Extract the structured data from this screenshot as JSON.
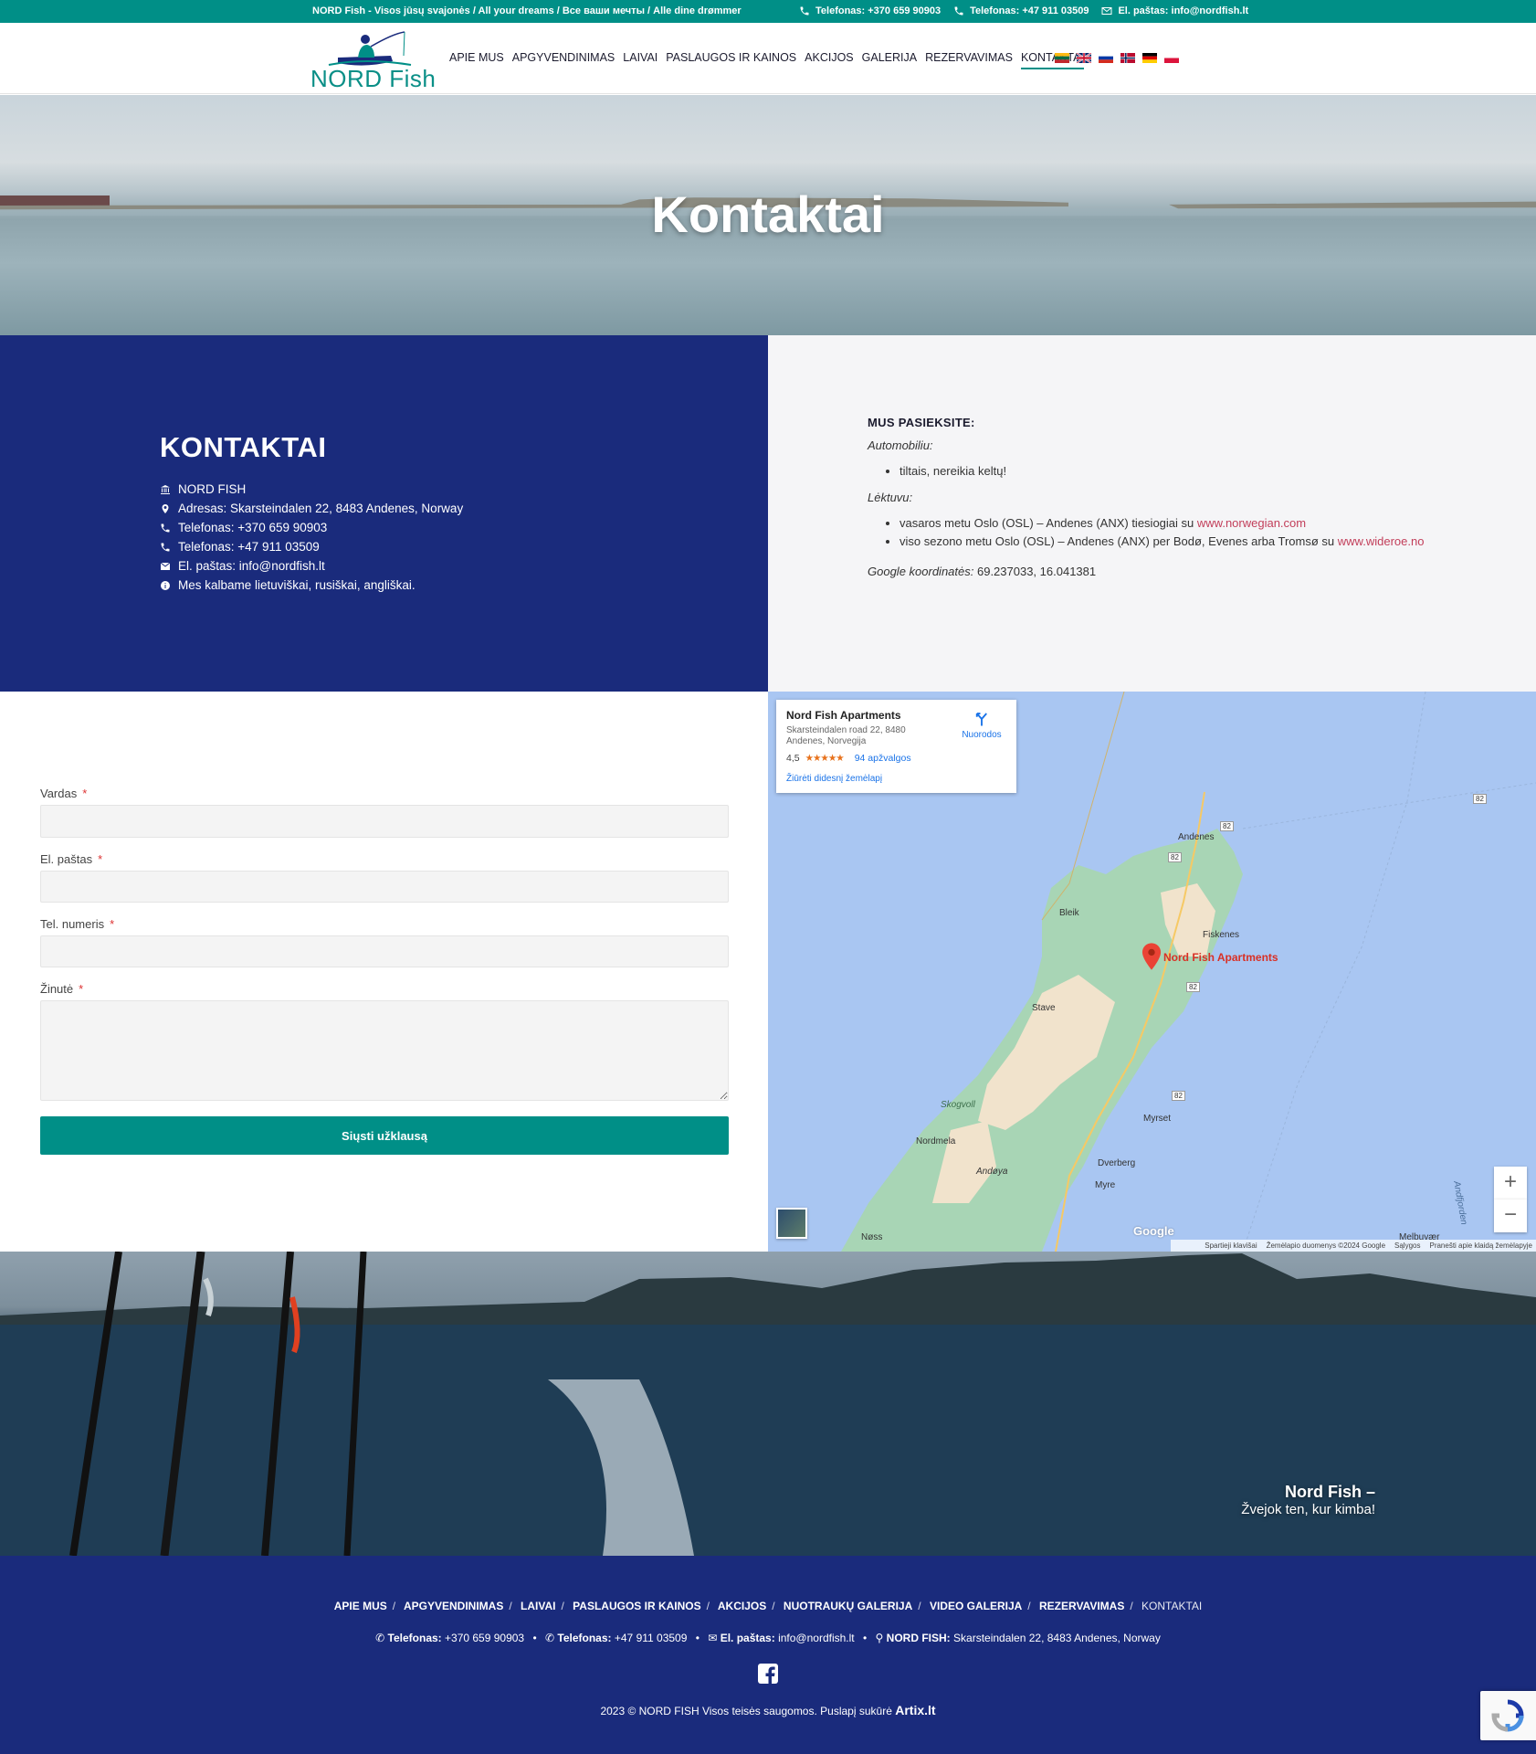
{
  "topbar": {
    "tagline": "NORD Fish - Visos jūsų svajonės / All your dreams / Все ваши мечты / Alle dine drømmer",
    "phone1": "Telefonas: +370 659 90903",
    "phone2": "Telefonas: +47 911 03509",
    "email": "El. paštas: info@nordfish.lt"
  },
  "header": {
    "logo_text": "NORD Fish",
    "nav": [
      "APIE MUS",
      "APGYVENDINIMAS",
      "LAIVAI",
      "PASLAUGOS IR KAINOS",
      "AKCIJOS",
      "GALERIJA",
      "REZERVAVIMAS",
      "KONTAKTAI"
    ],
    "active_index": 7,
    "flags": [
      "lt-flag",
      "en-flag",
      "ru-flag",
      "no-flag",
      "de-flag",
      "pl-flag"
    ]
  },
  "hero": {
    "title": "Kontaktai"
  },
  "contact": {
    "heading": "KONTAKTAI",
    "items": [
      {
        "icon": "bank-icon",
        "text": "NORD FISH"
      },
      {
        "icon": "map-marker-icon",
        "text": "Adresas: Skarsteindalen 22, 8483 Andenes, Norway"
      },
      {
        "icon": "phone-icon",
        "text": "Telefonas: +370 659 90903"
      },
      {
        "icon": "phone-icon",
        "text": "Telefonas: +47 911 03509"
      },
      {
        "icon": "envelope-icon",
        "text": "El. paštas: info@nordfish.lt"
      },
      {
        "icon": "info-icon",
        "text": "Mes kalbame lietuviškai, rusiškai, angliškai."
      }
    ]
  },
  "directions": {
    "heading": "MUS PASIEKSITE:",
    "car_label": "Automobiliu:",
    "car_items": [
      "tiltais, nereikia keltų!"
    ],
    "plane_label": "Lėktuvu:",
    "plane_item1_text": "vasaros metu Oslo (OSL) – Andenes (ANX) tiesiogiai su",
    "plane_item1_link": "www.norwegian.com",
    "plane_item2_text": "viso sezono metu Oslo (OSL) – Andenes (ANX) per Bodø, Evenes arba Tromsø su",
    "plane_item2_link": "www.wideroe.no",
    "coords_label": "Google koordinatės:",
    "coords_value": "69.237033, 16.041381"
  },
  "form": {
    "name_label": "Vardas",
    "email_label": "El. paštas",
    "phone_label": "Tel. numeris",
    "message_label": "Žinutė",
    "required_mark": "*",
    "submit_label": "Siųsti užklausą"
  },
  "map": {
    "card_title": "Nord Fish Apartments",
    "card_address": "Skarsteindalen road 22, 8480 Andenes, Norvegija",
    "rating": "4,5",
    "stars": "★★★★★",
    "reviews": "94 apžvalgos",
    "bigger_map": "Žiūrėti didesnį žemėlapį",
    "directions_label": "Nuorodos",
    "pin_label": "Nord Fish Apartments",
    "places": [
      "Andenes",
      "Bleik",
      "Fiskenes",
      "Stave",
      "Skogvoll",
      "Nordmela",
      "Andøya",
      "Myrset",
      "Dverberg",
      "Myre",
      "Nøss",
      "Andfjorden",
      "Melbuvær"
    ],
    "road_labels": [
      "82",
      "82",
      "82",
      "82",
      "82"
    ],
    "zoom_in": "+",
    "zoom_out": "−",
    "google": "Google",
    "footer_items": [
      "Spartieji klavišai",
      "Žemėlapio duomenys ©2024 Google",
      "Sąlygos",
      "Pranešti apie klaidą žemėlapyje"
    ]
  },
  "banner": {
    "line1": "Nord Fish –",
    "line2": "Žvejok ten, kur kimba!"
  },
  "footer": {
    "nav": [
      "APIE MUS",
      "APGYVENDINIMAS",
      "LAIVAI",
      "PASLAUGOS IR KAINOS",
      "AKCIJOS",
      "NUOTRAUKŲ GALERIJA",
      "VIDEO GALERIJA",
      "REZERVAVIMAS",
      "KONTAKTAI"
    ],
    "separator": "/",
    "phone1_label": "Telefonas:",
    "phone1_value": "+370 659 90903",
    "phone2_label": "Telefonas:",
    "phone2_value": "+47 911 03509",
    "email_label": "El. paštas:",
    "email_value": "info@nordfish.lt",
    "company_label": "NORD FISH:",
    "company_value": "Skarsteindalen 22, 8483 Andenes, Norway",
    "bullet": "•",
    "copyright": "2023 © NORD FISH Visos teisės saugomos. Puslapį sukūrė",
    "author": "Artix.lt"
  },
  "colors": {
    "teal": "#008f87",
    "navy": "#1a2b7c",
    "link_red": "#c23e5a",
    "map_water": "#a9c6f2",
    "map_land": "#a8d5b5"
  }
}
